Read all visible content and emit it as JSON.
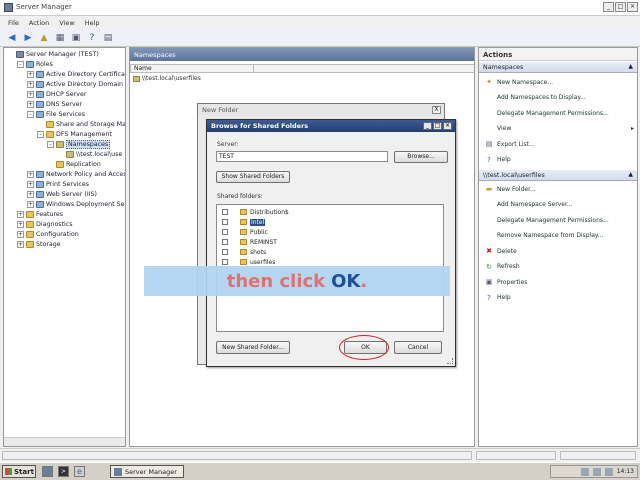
{
  "window": {
    "title": "Server Manager"
  },
  "menu": [
    "File",
    "Action",
    "View",
    "Help"
  ],
  "toolbar_icons": [
    "back-icon",
    "forward-icon",
    "up-folder-icon",
    "show-tree-icon",
    "properties-icon",
    "help-icon",
    "view-icon"
  ],
  "tree": [
    {
      "label": "Server Manager (TEST)",
      "level": 0,
      "exp": "",
      "icon": "server"
    },
    {
      "label": "Roles",
      "level": 1,
      "exp": "-",
      "icon": "role"
    },
    {
      "label": "Active Directory Certificate",
      "level": 2,
      "exp": "+",
      "icon": "role"
    },
    {
      "label": "Active Directory Domain Se",
      "level": 2,
      "exp": "+",
      "icon": "role"
    },
    {
      "label": "DHCP Server",
      "level": 2,
      "exp": "+",
      "icon": "role"
    },
    {
      "label": "DNS Server",
      "level": 2,
      "exp": "+",
      "icon": "role"
    },
    {
      "label": "File Services",
      "level": 2,
      "exp": "-",
      "icon": "role"
    },
    {
      "label": "Share and Storage Mar",
      "level": 3,
      "exp": "",
      "icon": "folder"
    },
    {
      "label": "DFS Management",
      "level": 3,
      "exp": "-",
      "icon": "folder"
    },
    {
      "label": "Namespaces",
      "level": 4,
      "exp": "-",
      "icon": "ns",
      "selected": true
    },
    {
      "label": "\\\\test.local\\use",
      "level": 5,
      "exp": "",
      "icon": "ns"
    },
    {
      "label": "Replication",
      "level": 4,
      "exp": "",
      "icon": "folder"
    },
    {
      "label": "Network Policy and Access",
      "level": 2,
      "exp": "+",
      "icon": "role"
    },
    {
      "label": "Print Services",
      "level": 2,
      "exp": "+",
      "icon": "role"
    },
    {
      "label": "Web Server (IIS)",
      "level": 2,
      "exp": "+",
      "icon": "role"
    },
    {
      "label": "Windows Deployment Servi",
      "level": 2,
      "exp": "+",
      "icon": "role"
    },
    {
      "label": "Features",
      "level": 1,
      "exp": "+",
      "icon": "folder"
    },
    {
      "label": "Diagnostics",
      "level": 1,
      "exp": "+",
      "icon": "folder"
    },
    {
      "label": "Configuration",
      "level": 1,
      "exp": "+",
      "icon": "folder"
    },
    {
      "label": "Storage",
      "level": 1,
      "exp": "+",
      "icon": "folder"
    }
  ],
  "center": {
    "header": "Namespaces",
    "column_name": "Name",
    "row": "\\\\test.local\\userfiles"
  },
  "actions": {
    "title": "Actions",
    "section1": "Namespaces",
    "items1": [
      {
        "label": "New Namespace...",
        "icon": "new-namespace-icon",
        "glyph": "✦",
        "color": "#c08a2a"
      },
      {
        "label": "Add Namespaces to Display...",
        "icon": "add-display-icon",
        "glyph": "",
        "color": "#333"
      },
      {
        "label": "Delegate Management Permissions...",
        "icon": "",
        "glyph": "",
        "color": "#333"
      },
      {
        "label": "View",
        "icon": "",
        "glyph": "",
        "color": "#333",
        "sub": "▸"
      },
      {
        "label": "Export List...",
        "icon": "export-icon",
        "glyph": "▤",
        "color": "#557"
      },
      {
        "label": "Help",
        "icon": "help-icon",
        "glyph": "?",
        "color": "#2a55a0"
      }
    ],
    "section2": "\\\\test.local\\userfiles",
    "items2": [
      {
        "label": "New Folder...",
        "icon": "new-folder-icon",
        "glyph": "▬",
        "color": "#c8a030"
      },
      {
        "label": "Add Namespace Server...",
        "icon": "",
        "glyph": "",
        "color": "#333"
      },
      {
        "label": "Delegate Management Permissions...",
        "icon": "",
        "glyph": "",
        "color": "#333"
      },
      {
        "label": "Remove Namespace from Display...",
        "icon": "",
        "glyph": "",
        "color": "#333"
      },
      {
        "label": "Delete",
        "icon": "delete-icon",
        "glyph": "✖",
        "color": "#c02020"
      },
      {
        "label": "Refresh",
        "icon": "refresh-icon",
        "glyph": "↻",
        "color": "#3a8a3a"
      },
      {
        "label": "Properties",
        "icon": "properties-icon",
        "glyph": "▣",
        "color": "#557"
      },
      {
        "label": "Help",
        "icon": "help-icon",
        "glyph": "?",
        "color": "#2a55a0"
      }
    ]
  },
  "new_folder_dialog": {
    "title": "New Folder",
    "close": "X"
  },
  "browse_dialog": {
    "title": "Browse for Shared Folders",
    "server_label": "Server:",
    "server_value": "TEST",
    "browse_button": "Browse...",
    "show_shared_button": "Show Shared Folders",
    "shared_label": "Shared folders:",
    "folders": [
      {
        "name": "Distribution$",
        "selected": false
      },
      {
        "name": "Intel",
        "selected": true
      },
      {
        "name": "Public",
        "selected": false
      },
      {
        "name": "REMINST",
        "selected": false
      },
      {
        "name": "shots",
        "selected": false
      },
      {
        "name": "userfiles",
        "selected": false
      }
    ],
    "new_shared_button": "New Shared Folder...",
    "ok_button": "OK",
    "cancel_button": "Cancel"
  },
  "caption": {
    "part1": "then click",
    "part2": "OK",
    "part3": "."
  },
  "taskbar": {
    "start": "Start",
    "task": "Server Manager",
    "clock": "14:13"
  }
}
